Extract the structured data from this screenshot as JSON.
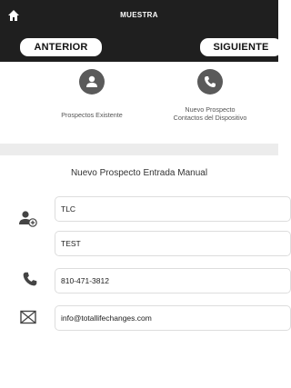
{
  "header": {
    "title": "MUESTRA",
    "prev_label": "ANTERIOR",
    "next_label": "SIGUIENTE"
  },
  "options": [
    {
      "label": "Prospectos Existente",
      "icon": "person-icon"
    },
    {
      "label_line1": "Nuevo Prospecto",
      "label_line2": "Contactos del Dispositivo",
      "icon": "phone-icon"
    }
  ],
  "form": {
    "title": "Nuevo Prospecto Entrada Manual",
    "first_name": "TLC",
    "last_name": "TEST",
    "phone": "810-471-3812",
    "email": "info@totallifechanges.com"
  },
  "colors": {
    "header_bg": "#1f1f1f",
    "icon_gray": "#5a5a5a",
    "divider_bg": "#ececec"
  }
}
